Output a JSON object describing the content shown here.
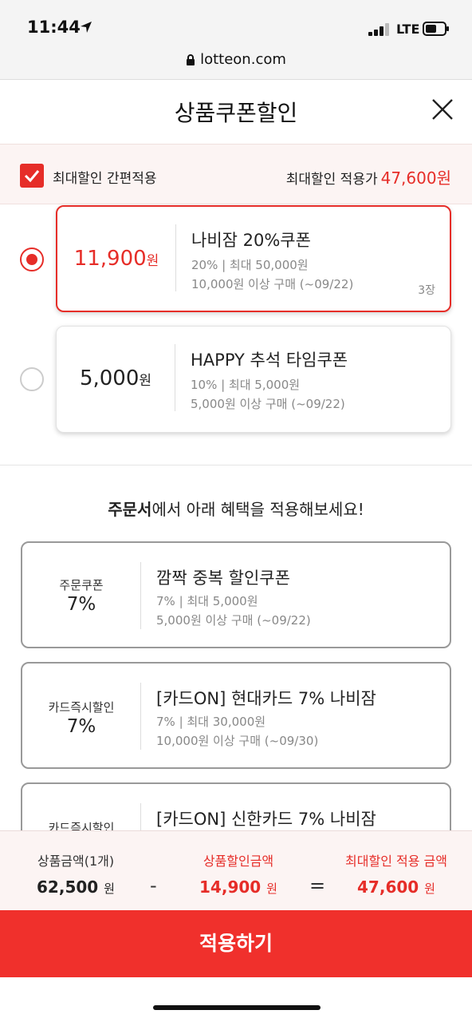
{
  "status_bar": {
    "time": "11:44",
    "network": "LTE"
  },
  "browser": {
    "url": "lotteon.com"
  },
  "header": {
    "title": "상품쿠폰할인"
  },
  "max_discount": {
    "checkbox_label": "최대할인 간편적용",
    "checked": true,
    "applied_label": "최대할인 적용가",
    "applied_amount": "47,600원"
  },
  "product_coupons": [
    {
      "amount": "11,900",
      "unit": "원",
      "name": "나비잠 20%쿠폰",
      "line1": "20% | 최대 50,000원",
      "line2": "10,000원 이상 구매 (~09/22)",
      "qty": "3장",
      "selected": true
    },
    {
      "amount": "5,000",
      "unit": "원",
      "name": "HAPPY 추석 타임쿠폰",
      "line1": "10% | 최대 5,000원",
      "line2": "5,000원 이상 구매 (~09/22)",
      "qty": "",
      "selected": false
    }
  ],
  "promo": {
    "bold": "주문서",
    "rest": "에서 아래 혜택을 적용해보세요!"
  },
  "order_coupons": [
    {
      "kind": "주문쿠폰",
      "pct": "7%",
      "name": "깜짝 중복 할인쿠폰",
      "line1": "7% | 최대 5,000원",
      "line2": "5,000원 이상 구매 (~09/22)"
    },
    {
      "kind": "카드즉시할인",
      "pct": "7%",
      "name": "[카드ON] 현대카드 7% 나비잠",
      "line1": "7% | 최대 30,000원",
      "line2": "10,000원 이상 구매 (~09/30)"
    },
    {
      "kind": "카드즉시할인",
      "pct": "",
      "name": "[카드ON] 신한카드 7% 나비잠",
      "line1": "",
      "line2": ""
    }
  ],
  "summary": {
    "product_label": "상품금액(1개)",
    "product_value": "62,500",
    "minus": "-",
    "discount_label": "상품할인금액",
    "discount_value": "14,900",
    "equals": "=",
    "final_label": "최대할인 적용 금액",
    "final_value": "47,600",
    "unit": "원"
  },
  "apply_button": "적용하기",
  "colors": {
    "accent": "#e62d28",
    "button": "#f0302c"
  }
}
